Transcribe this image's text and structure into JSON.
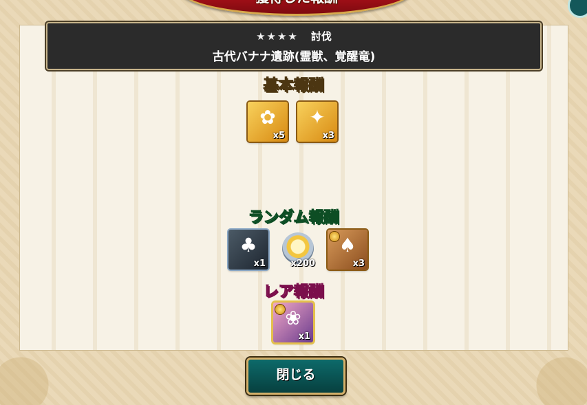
{
  "dialog": {
    "title": "獲得した報酬",
    "close_label": "閉じる"
  },
  "quest": {
    "stars": "★★★★",
    "type": "討伐",
    "name": "古代バナナ遺跡(霊獣、覚醒竜)"
  },
  "sections": {
    "basic": "基本報酬",
    "random": "ランダム報酬",
    "rare": "レア報酬"
  },
  "basic_rewards": [
    {
      "icon": "blue-spirit-girl-icon",
      "qty": "x5"
    },
    {
      "icon": "pink-dragon-icon",
      "qty": "x3"
    }
  ],
  "random_rewards": [
    {
      "icon": "hooded-girl-icon",
      "qty": "x1"
    },
    {
      "icon": "golden-heart-orb-icon",
      "qty": "x200"
    },
    {
      "icon": "green-hat-girl-icon",
      "qty": "x3"
    }
  ],
  "rare_rewards": [
    {
      "icon": "purple-hair-girl-icon",
      "qty": "x1"
    }
  ],
  "colors": {
    "header_bg": "#2b2b2b",
    "random_title": "#8ff29a",
    "rare_title": "#ff9bd8",
    "close_button": "#0d6a6a"
  }
}
